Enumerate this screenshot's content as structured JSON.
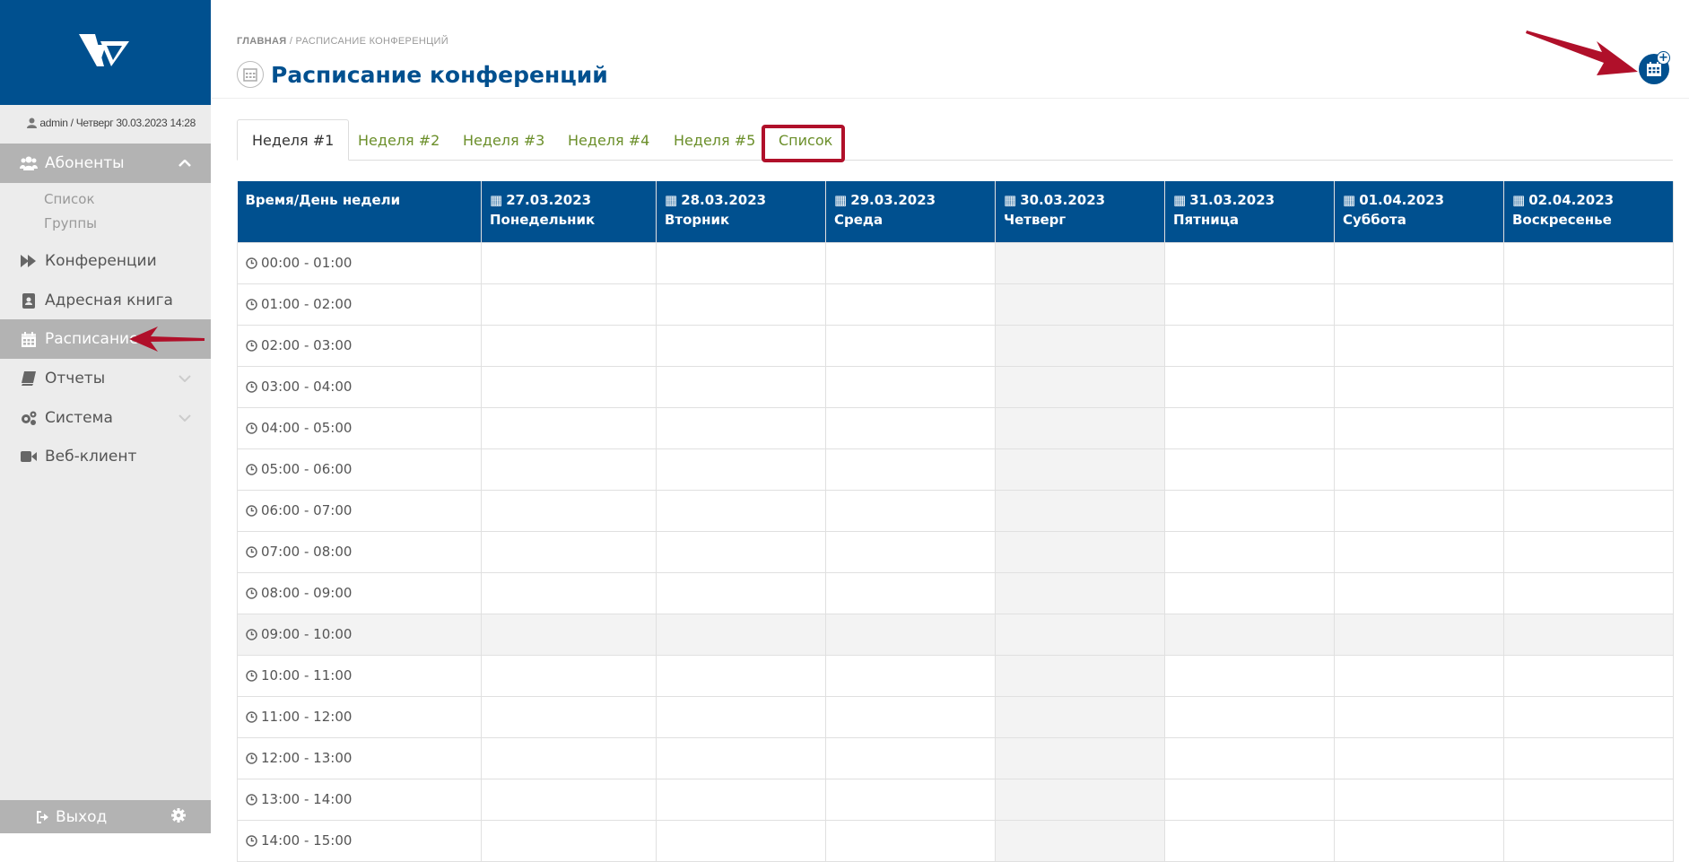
{
  "sidebar": {
    "user_line": "admin / Четверг 30.03.2023 14:28",
    "items": [
      {
        "label": "Абоненты",
        "icon": "users-icon",
        "active": true,
        "chevron": "up"
      },
      {
        "label": "Конференции",
        "icon": "forward-icon"
      },
      {
        "label": "Адресная книга",
        "icon": "address-book-icon"
      },
      {
        "label": "Расписание",
        "icon": "calendar-icon",
        "active": true
      },
      {
        "label": "Отчеты",
        "icon": "book-icon",
        "chevron": "down"
      },
      {
        "label": "Система",
        "icon": "cogs-icon",
        "chevron": "down"
      },
      {
        "label": "Веб-клиент",
        "icon": "video-camera-icon"
      }
    ],
    "subitems": [
      "Список",
      "Группы"
    ],
    "logout_label": "Выход"
  },
  "header": {
    "breadcrumb_home": "ГЛАВНАЯ",
    "breadcrumb_current": "/ РАСПИСАНИЕ КОНФЕРЕНЦИЙ",
    "title": "Расписание конференций"
  },
  "tabs": [
    "Неделя #1",
    "Неделя #2",
    "Неделя #3",
    "Неделя #4",
    "Неделя #5",
    "Список"
  ],
  "table": {
    "corner_header": "Время/День недели",
    "days": [
      {
        "date": "27.03.2023",
        "dow": "Понедельник"
      },
      {
        "date": "28.03.2023",
        "dow": "Вторник"
      },
      {
        "date": "29.03.2023",
        "dow": "Среда"
      },
      {
        "date": "30.03.2023",
        "dow": "Четверг"
      },
      {
        "date": "31.03.2023",
        "dow": "Пятница"
      },
      {
        "date": "01.04.2023",
        "dow": "Суббота"
      },
      {
        "date": "02.04.2023",
        "dow": "Воскресенье"
      }
    ],
    "slots": [
      "00:00 - 01:00",
      "01:00 - 02:00",
      "02:00 - 03:00",
      "03:00 - 04:00",
      "04:00 - 05:00",
      "05:00 - 06:00",
      "06:00 - 07:00",
      "07:00 - 08:00",
      "08:00 - 09:00",
      "09:00 - 10:00",
      "10:00 - 11:00",
      "11:00 - 12:00",
      "12:00 - 13:00",
      "13:00 - 14:00",
      "14:00 - 15:00"
    ]
  },
  "colors": {
    "brand": "#00508f",
    "tab_link": "#6b8f2a",
    "highlight": "#b0102a",
    "sidebar_active": "#b3b3b3"
  }
}
